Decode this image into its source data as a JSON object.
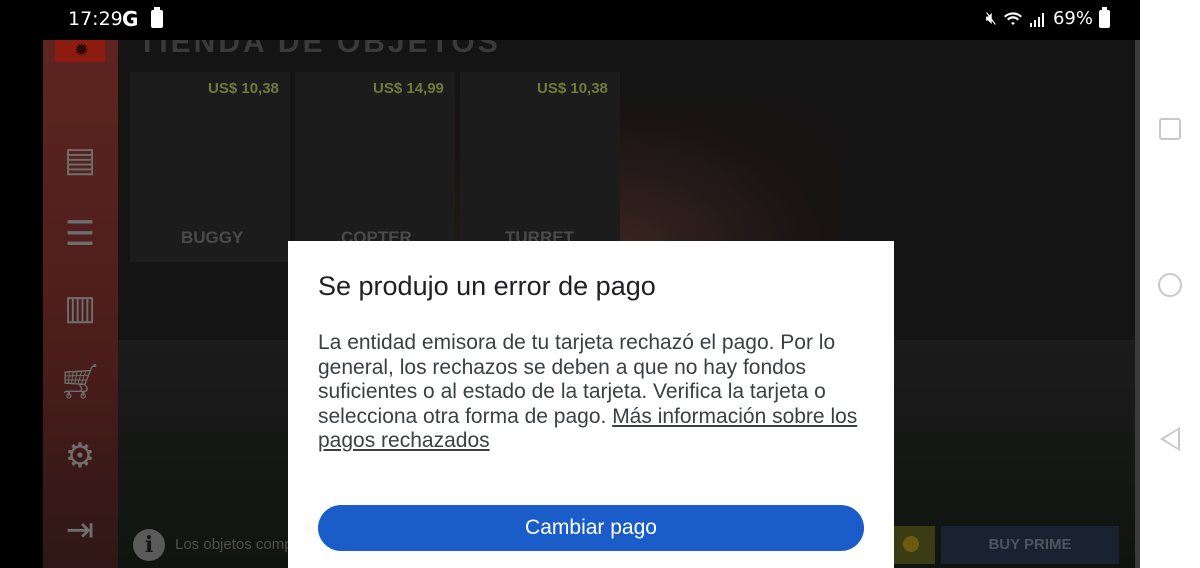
{
  "status_bar": {
    "time": "17:29",
    "g_label": "G",
    "battery": "69%"
  },
  "game": {
    "shop_title": "TIENDA DE OBJETOS",
    "items": [
      {
        "price": "US$ 10,38",
        "name": "BUGGY"
      },
      {
        "price": "US$ 14,99",
        "name": "COPTER"
      },
      {
        "price": "US$ 10,38",
        "name": "TURRET"
      }
    ],
    "footer_note": "Los objetos compr",
    "buy_prime_label": "BUY PRIME",
    "sidebar_icons": [
      "news-icon",
      "list-icon",
      "stats-icon",
      "cart-icon",
      "settings-icon",
      "exit-icon"
    ]
  },
  "dialog": {
    "title": "Se produjo un error de pago",
    "body": "La entidad emisora de tu tarjeta rechazó el pago. Por lo general, los rechazos se deben a que no hay fondos suficientes o al estado de la tarjeta. Verifica la tarjeta o selecciona otra forma de pago. ",
    "link": "Más información sobre los pagos rechazados",
    "button_label": "Cambiar pago"
  },
  "colors": {
    "primary_button": "#1a5dc8",
    "dialog_bg": "#ffffff",
    "sidebar_red": "#5e2520"
  }
}
